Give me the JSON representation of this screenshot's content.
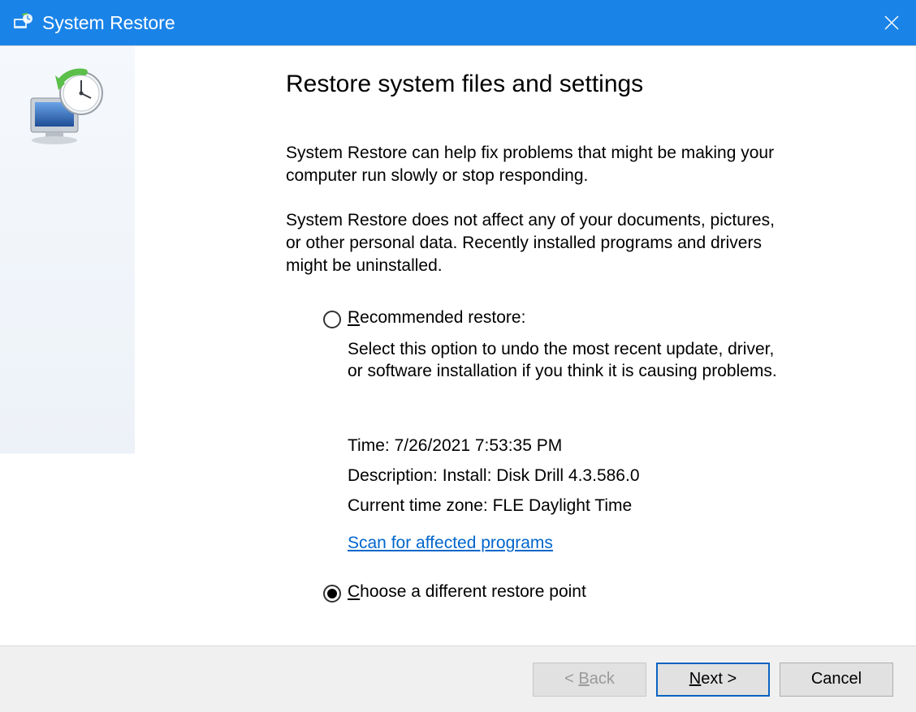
{
  "titlebar": {
    "title": "System Restore",
    "icon_name": "system-restore-icon"
  },
  "main": {
    "heading": "Restore system files and settings",
    "paragraph1": "System Restore can help fix problems that might be making your computer run slowly or stop responding.",
    "paragraph2": "System Restore does not affect any of your documents, pictures, or other personal data. Recently installed programs and drivers might be uninstalled.",
    "option_recommended": {
      "label": "Recommended restore:",
      "description": "Select this option to undo the most recent update, driver, or software installation if you think it is causing problems.",
      "selected": false
    },
    "restore_point": {
      "time_label": "Time:",
      "time_value": "7/26/2021 7:53:35 PM",
      "description_label": "Description:",
      "description_value": "Install: Disk Drill 4.3.586.0",
      "timezone_label": "Current time zone:",
      "timezone_value": "FLE Daylight Time"
    },
    "scan_link": "Scan for affected programs",
    "option_choose": {
      "label": "Choose a different restore point",
      "selected": true
    }
  },
  "footer": {
    "back": "< Back",
    "next": "Next >",
    "cancel": "Cancel",
    "back_enabled": false
  }
}
